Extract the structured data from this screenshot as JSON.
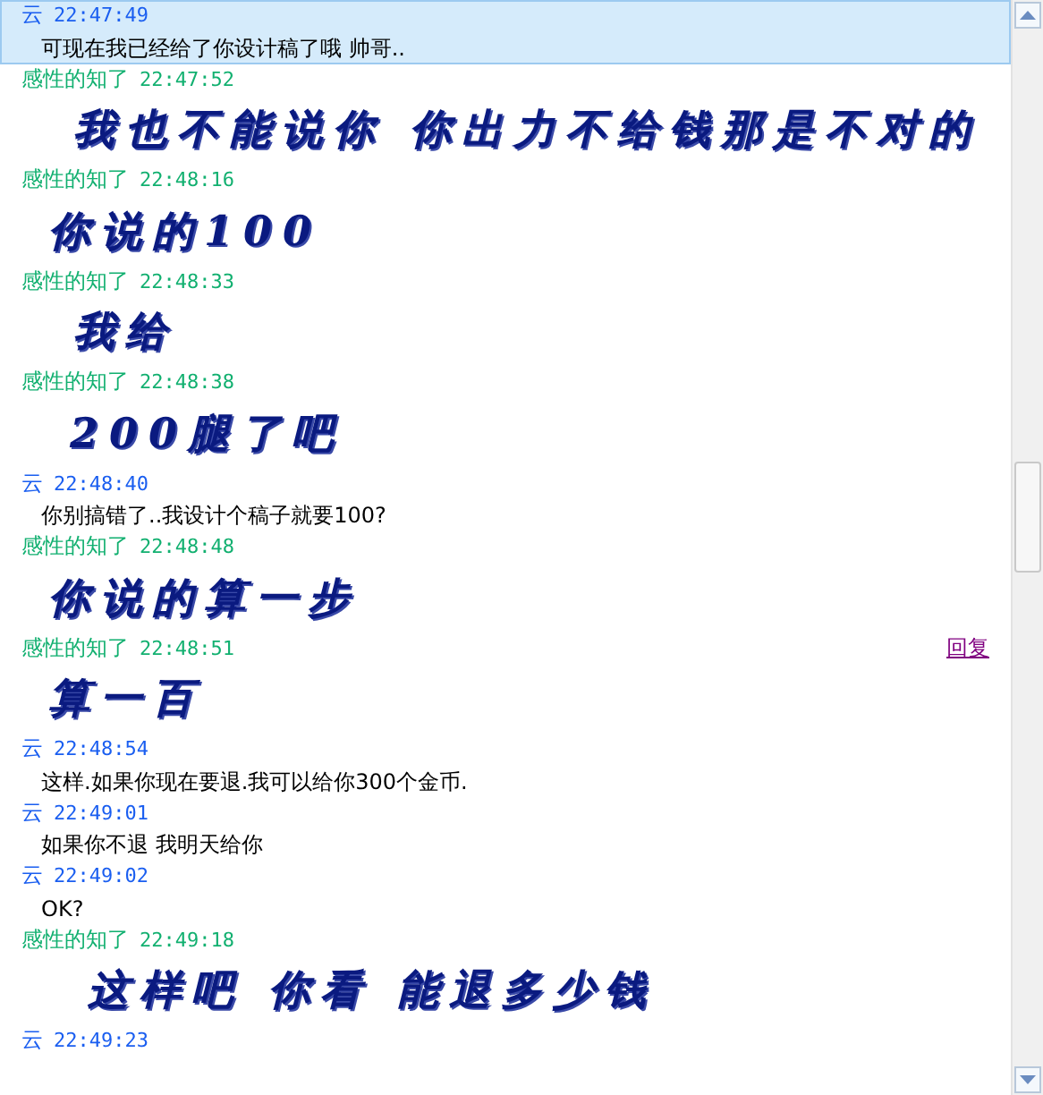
{
  "messages": [
    {
      "sender": "云",
      "time": "22:47:49",
      "color": "#1a5ef0",
      "kind": "text",
      "text": "可现在我已经给了你设计稿了哦 帅哥..",
      "selected": true
    },
    {
      "sender": "感性的知了",
      "time": "22:47:52",
      "color": "#12b070",
      "kind": "art",
      "text": "我也不能说你 你出力不给钱那是不对的",
      "selected": false
    },
    {
      "sender": "感性的知了",
      "time": "22:48:16",
      "color": "#12b070",
      "kind": "art",
      "text": "你说的100",
      "selected": false
    },
    {
      "sender": "感性的知了",
      "time": "22:48:33",
      "color": "#12b070",
      "kind": "art",
      "text": "我给",
      "selected": false
    },
    {
      "sender": "感性的知了",
      "time": "22:48:38",
      "color": "#12b070",
      "kind": "art",
      "text": "200腿了吧",
      "selected": false
    },
    {
      "sender": "云",
      "time": "22:48:40",
      "color": "#1a5ef0",
      "kind": "text",
      "text": "你别搞错了..我设计个稿子就要100?",
      "selected": false
    },
    {
      "sender": "感性的知了",
      "time": "22:48:48",
      "color": "#12b070",
      "kind": "art",
      "text": "你说的算一步",
      "selected": false
    },
    {
      "sender": "感性的知了",
      "time": "22:48:51",
      "color": "#12b070",
      "kind": "art",
      "text": "算一百",
      "selected": false,
      "reply": "回复"
    },
    {
      "sender": "云",
      "time": "22:48:54",
      "color": "#1a5ef0",
      "kind": "text",
      "text": "这样.如果你现在要退.我可以给你300个金币.",
      "selected": false
    },
    {
      "sender": "云",
      "time": "22:49:01",
      "color": "#1a5ef0",
      "kind": "text",
      "text": "如果你不退 我明天给你",
      "selected": false
    },
    {
      "sender": "云",
      "time": "22:49:02",
      "color": "#1a5ef0",
      "kind": "text",
      "text": "OK?",
      "selected": false
    },
    {
      "sender": "感性的知了",
      "time": "22:49:18",
      "color": "#12b070",
      "kind": "art",
      "text": "这样吧 你看 能退多少钱",
      "selected": false
    },
    {
      "sender": "云",
      "time": "22:49:23",
      "color": "#1a5ef0",
      "kind": "none",
      "selected": false
    }
  ]
}
